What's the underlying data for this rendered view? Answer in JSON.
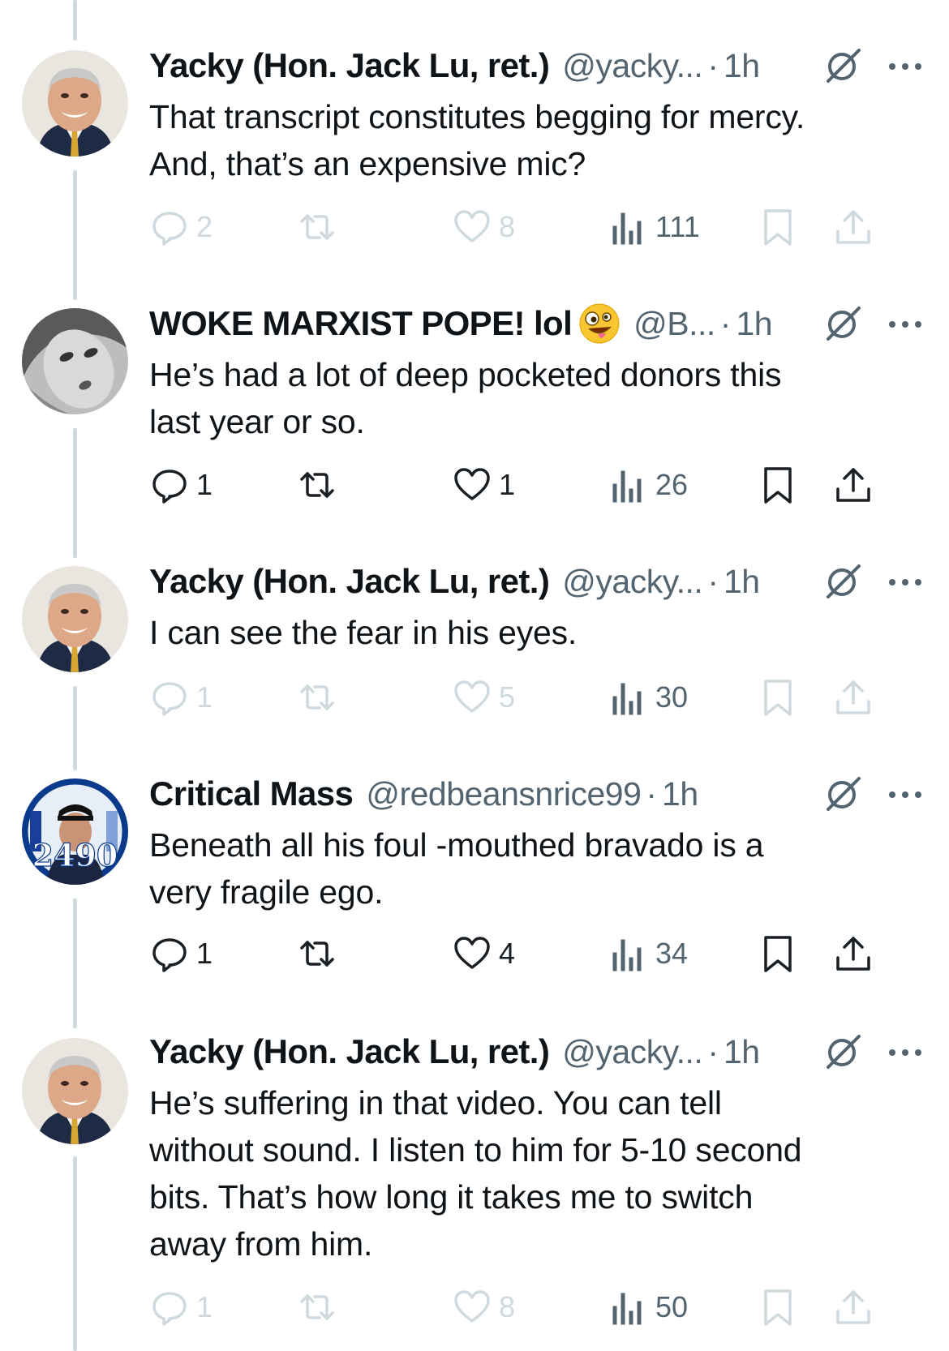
{
  "posts": [
    {
      "name": "Yacky (Hon. Jack Lu, ret.)",
      "handle": "@yacky...",
      "time": "1h",
      "text_lines": [
        "That transcript constitutes begging for mercy.",
        "And, that’s an expensive mic?"
      ],
      "replies": "2",
      "likes": "8",
      "views": "111",
      "action_style": "dim"
    },
    {
      "name": "WOKE MARXIST POPE! lol",
      "handle": "@B...",
      "time": "1h",
      "text_lines": [
        "He’s had a lot of deep pocketed donors this",
        "last year or so."
      ],
      "replies": "1",
      "likes": "1",
      "views": "26",
      "action_style": "dark"
    },
    {
      "name": "Yacky (Hon. Jack Lu, ret.)",
      "handle": "@yacky...",
      "time": "1h",
      "text_lines": [
        "I can see the fear in his eyes."
      ],
      "replies": "1",
      "likes": "5",
      "views": "30",
      "action_style": "dim"
    },
    {
      "name": "Critical Mass",
      "handle": "@redbeansnrice99",
      "time": "1h",
      "text_lines": [
        "Beneath all his foul -mouthed bravado is a",
        "very fragile ego."
      ],
      "replies": "1",
      "likes": "4",
      "views": "34",
      "action_style": "dark",
      "avatar_badge": "2490"
    },
    {
      "name": "Yacky (Hon. Jack Lu, ret.)",
      "handle": "@yacky...",
      "time": "1h",
      "text_lines": [
        "He’s suffering in that video. You can tell",
        "without sound. I listen to him for 5-10 second",
        "bits. That’s how long it takes me to switch",
        "away from him."
      ],
      "replies": "1",
      "likes": "8",
      "views": "50",
      "action_style": "dim"
    }
  ],
  "separator": "·",
  "icons": {
    "reply": "reply-icon",
    "repost": "repost-icon",
    "like": "like-icon",
    "views": "views-icon",
    "bookmark": "bookmark-icon",
    "share": "share-icon",
    "grok": "grok-icon",
    "more": "more-icon",
    "emoji": "zany-face-emoji"
  },
  "colors": {
    "text": "#0f1419",
    "secondary": "#536471",
    "faded": "#cfd9de",
    "line": "#cfd9de"
  }
}
